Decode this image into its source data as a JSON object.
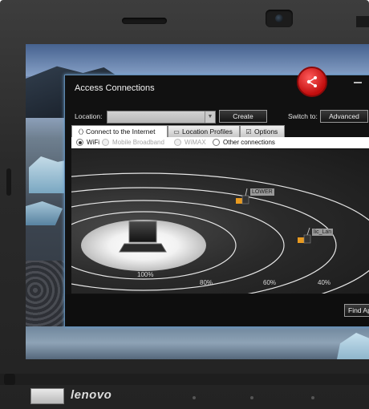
{
  "device": {
    "brand": "lenovo"
  },
  "window": {
    "title": "Access Connections",
    "location_label": "Location:",
    "location_value": "",
    "create_label": "Create",
    "switch_to_label": "Switch to:",
    "advanced_label": "Advanced",
    "find_label": "Find Ap",
    "accent_color": "#d81818"
  },
  "tabs": [
    {
      "label": "Connect to the Internet",
      "icon": "network-icon",
      "selected": true
    },
    {
      "label": "Location Profiles",
      "icon": "folder-icon",
      "selected": false
    },
    {
      "label": "Options",
      "icon": "checkbox-icon",
      "selected": false
    }
  ],
  "connection_types": [
    {
      "label": "WiFi",
      "selected": true,
      "enabled": true
    },
    {
      "label": "Mobile Broadband",
      "selected": false,
      "enabled": false
    },
    {
      "label": "WiMAX",
      "selected": false,
      "enabled": false
    },
    {
      "label": "Other connections",
      "selected": false,
      "enabled": true
    }
  ],
  "signal_map": {
    "rings": [
      "100%",
      "80%",
      "60%",
      "40%"
    ],
    "access_points": [
      {
        "name": "LOWER",
        "icon": "router-icon"
      },
      {
        "name": "lic_Lan",
        "icon": "router-icon"
      }
    ]
  }
}
